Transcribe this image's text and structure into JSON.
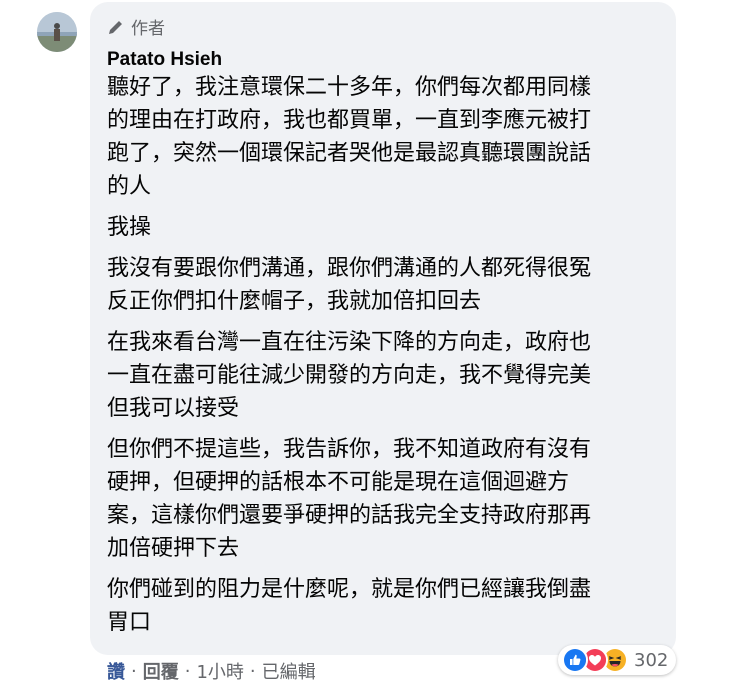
{
  "comment": {
    "badge_label": "作者",
    "author_name": "Patato Hsieh",
    "paragraphs": [
      "聽好了，我注意環保二十多年，你們每次都用同樣\n的理由在打政府，我也都買單，一直到李應元被打\n跑了，突然一個環保記者哭他是最認真聽環團說話\n的人",
      "我操",
      "我沒有要跟你們溝通，跟你們溝通的人都死得很冤\n反正你們扣什麼帽子，我就加倍扣回去",
      "在我來看台灣一直在往污染下降的方向走，政府也\n一直在盡可能往減少開發的方向走，我不覺得完美\n但我可以接受",
      "但你們不提這些，我告訴你，我不知道政府有沒有\n硬押，但硬押的話根本不可能是現在這個迴避方\n案，這樣你們還要爭硬押的話我完全支持政府那再\n加倍硬押下去",
      "你們碰到的阻力是什麼呢，就是你們已經讓我倒盡\n胃口"
    ]
  },
  "actions": {
    "like_label": "讚",
    "reply_label": "回覆",
    "time_label": "1小時",
    "edited_label": "已編輯",
    "separator": "·"
  },
  "reactions": {
    "count": "302",
    "icons": [
      "like-reaction-icon",
      "love-reaction-icon",
      "haha-reaction-icon"
    ],
    "colors": {
      "like": "#1877f2",
      "love": "#f33e58",
      "haha": "#f7b125"
    }
  }
}
